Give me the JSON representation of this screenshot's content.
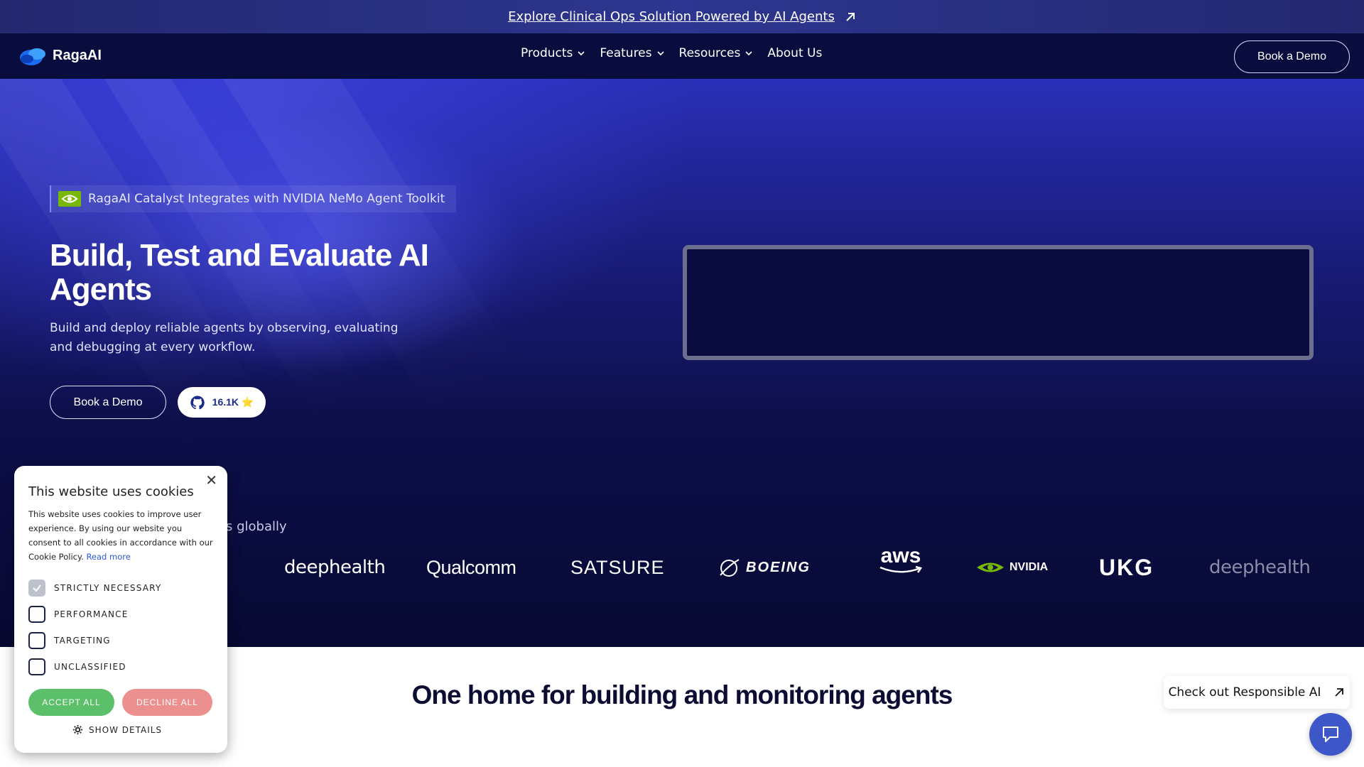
{
  "announcement": {
    "text": "Explore Clinical Ops Solution Powered by AI Agents"
  },
  "nav": {
    "brand": "RagaAI",
    "items": [
      {
        "label": "Products",
        "dropdown": true
      },
      {
        "label": "Features",
        "dropdown": true
      },
      {
        "label": "Resources",
        "dropdown": true
      },
      {
        "label": "About Us",
        "dropdown": false
      }
    ],
    "cta_label": "Book a Demo"
  },
  "hero": {
    "badge_text": "RagaAI Catalyst Integrates with NVIDIA NeMo Agent Toolkit",
    "title": "Build, Test and Evaluate AI Agents",
    "subtitle": "Build and deploy reliable agents by observing, evaluating and debugging at every workflow.",
    "demo_label": "Book a Demo",
    "github_stars": "16.1K ⭐"
  },
  "trusted": {
    "visible_text": "s globally",
    "logos": [
      "deephealth",
      "Qualcomm",
      "SATSURE",
      "BOEING",
      "aws",
      "NVIDIA",
      "UKG",
      "deephealth"
    ]
  },
  "section": {
    "title": "One home for building and monitoring agents",
    "responsible_label": "Check out Responsible AI"
  },
  "cookie": {
    "title": "This website uses cookies",
    "body": "This website uses cookies to improve user experience. By using our website you consent to all cookies in accordance with our Cookie Policy.",
    "read_more": "Read more",
    "options": [
      {
        "label": "STRICTLY NECESSARY",
        "checked": true
      },
      {
        "label": "PERFORMANCE",
        "checked": false
      },
      {
        "label": "TARGETING",
        "checked": false
      },
      {
        "label": "UNCLASSIFIED",
        "checked": false
      }
    ],
    "accept_label": "ACCEPT ALL",
    "decline_label": "DECLINE ALL",
    "details_label": "SHOW DETAILS"
  },
  "colors": {
    "announce_bg": "#2d3690",
    "nav_bg": "#090d3e",
    "accept_green": "#5cbf6a",
    "decline_red": "#ec8f8f",
    "chat_blue": "#3d57c9"
  }
}
